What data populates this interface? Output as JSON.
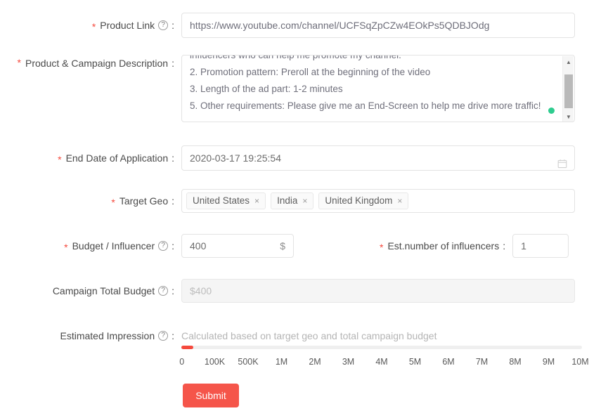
{
  "theme": {
    "accent": "#f5554a",
    "required_asterisk": "#f5493d",
    "status_dot": "#2ecc8f",
    "border": "#e3e3e3",
    "disabled_bg": "#f5f5f5"
  },
  "icons": {
    "help": "?",
    "calendar": "calendar-icon",
    "tag_remove": "×",
    "scroll_up": "▲",
    "scroll_down": "▼"
  },
  "form": {
    "product_link": {
      "label": "Product Link",
      "required": true,
      "has_help": true,
      "colon": ":",
      "value": "https://www.youtube.com/channel/UCFSqZpCZw4EOkPs5QDBJOdg"
    },
    "description": {
      "label": "Product & Campaign Description",
      "required": true,
      "has_help": false,
      "colon": ":",
      "value": "influencers who can help me promote my channel.\n2. Promotion pattern: Preroll at the beginning of the video\n3. Length of the ad part: 1-2 minutes\n5. Other requirements: Please give me an End-Screen to help me drive more traffic!"
    },
    "end_date": {
      "label": "End Date of Application",
      "required": true,
      "has_help": false,
      "colon": ":",
      "value": "2020-03-17 19:25:54"
    },
    "target_geo": {
      "label": "Target Geo",
      "required": true,
      "has_help": false,
      "colon": ":",
      "tags": [
        "United States",
        "India",
        "United Kingdom"
      ]
    },
    "budget_per_influencer": {
      "label": "Budget / Influencer",
      "required": true,
      "has_help": true,
      "colon": ":",
      "value": "400",
      "suffix": "$"
    },
    "est_number_of_influencers": {
      "label": "Est.number of influencers",
      "required": true,
      "has_help": false,
      "colon": ":",
      "value": "1"
    },
    "campaign_total_budget": {
      "label": "Campaign Total Budget",
      "required": false,
      "has_help": true,
      "colon": ":",
      "value": "$400",
      "disabled": true
    },
    "estimated_impression": {
      "label": "Estimated Impression",
      "required": false,
      "has_help": true,
      "colon": ":",
      "hint": "Calculated based on target geo and total campaign budget"
    },
    "submit": {
      "label": "Submit"
    }
  },
  "slider": {
    "ticks": [
      "0",
      "100K",
      "500K",
      "1M",
      "2M",
      "3M",
      "4M",
      "5M",
      "6M",
      "7M",
      "8M",
      "9M",
      "10M"
    ],
    "fill_percent": 3,
    "value": "0"
  }
}
